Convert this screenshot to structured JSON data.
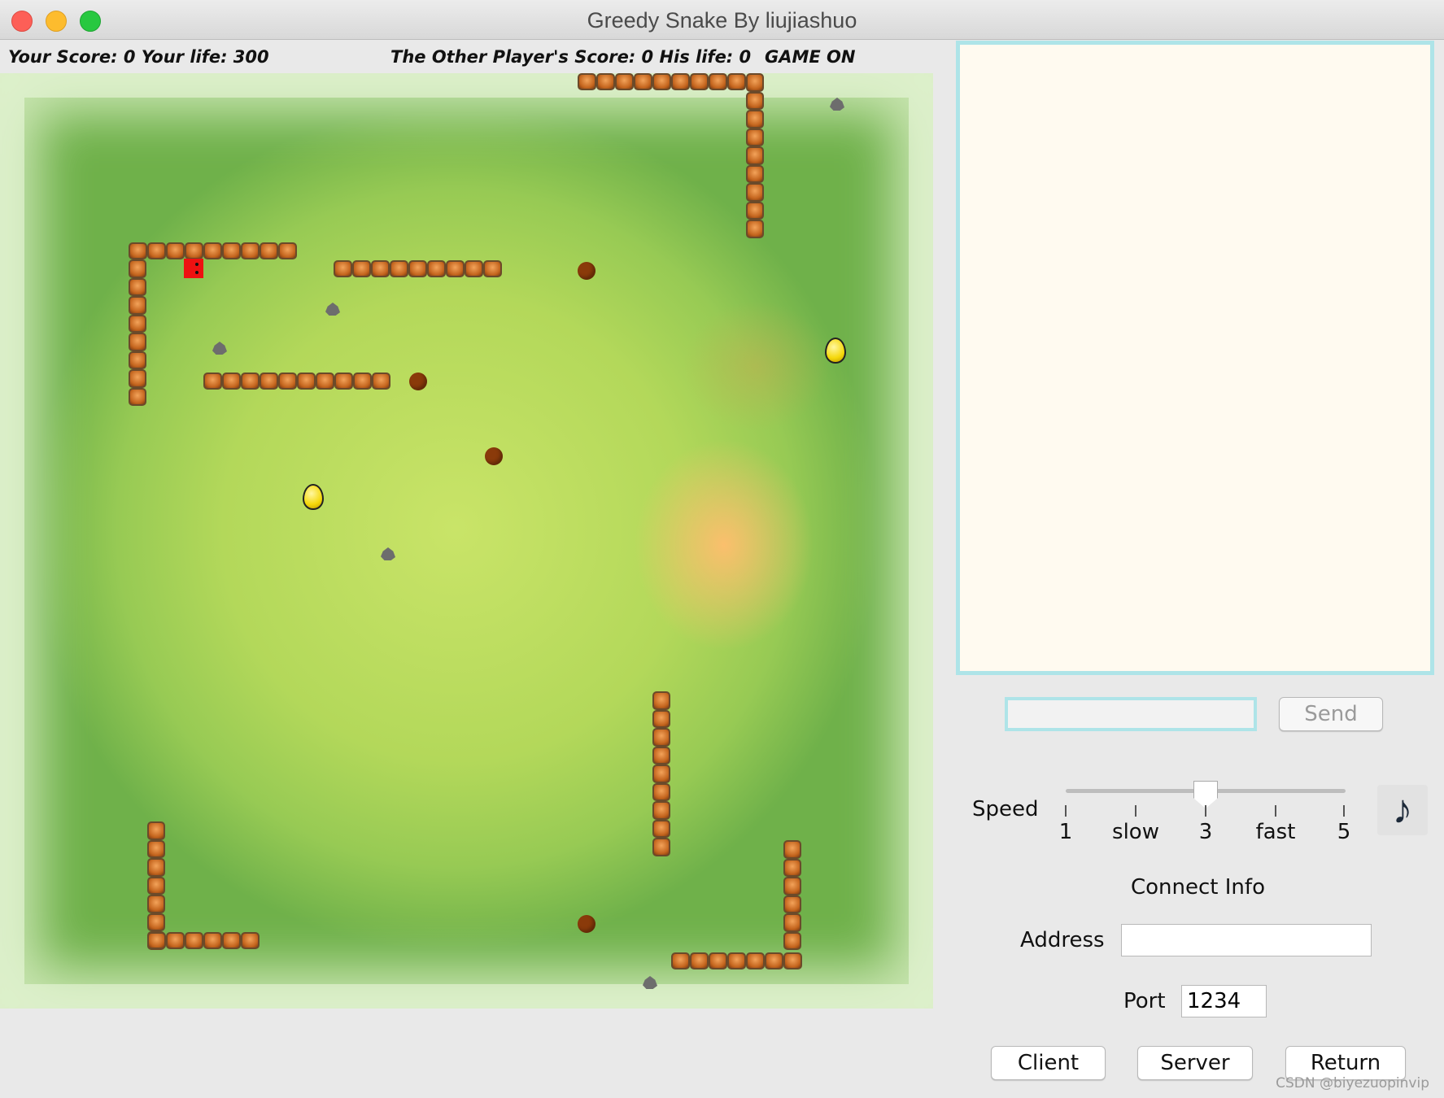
{
  "window": {
    "title": "Greedy Snake By liujiashuo"
  },
  "status": {
    "your_score": "Your Score: 0 Your life: 300",
    "other_score": "The Other Player's Score: 0 His life: 0",
    "game_state": "GAME ON"
  },
  "game": {
    "snake": {
      "head_color": "#ee1111",
      "length": 1
    },
    "counts": {
      "food": 4,
      "eggs": 2,
      "rocks": 5
    },
    "colors": {
      "brick": "#c4651e",
      "food": "#8a3a0a",
      "egg": "#f5d80a",
      "rock": "#6d6d6d",
      "grass": "#b3d85a"
    }
  },
  "chat": {
    "input_value": "",
    "send_label": "Send"
  },
  "speed": {
    "label": "Speed",
    "value": 3,
    "min": 1,
    "max": 5,
    "ticks": [
      "1",
      "slow",
      "3",
      "fast",
      "5"
    ]
  },
  "music_icon": "music-note-icon",
  "connect": {
    "heading": "Connect Info",
    "address_label": "Address",
    "address_value": "",
    "port_label": "Port",
    "port_value": "1234"
  },
  "buttons": {
    "client": "Client",
    "server": "Server",
    "return": "Return"
  },
  "watermark": "CSDN @biyezuopinvip",
  "accent": "#aee4e8"
}
